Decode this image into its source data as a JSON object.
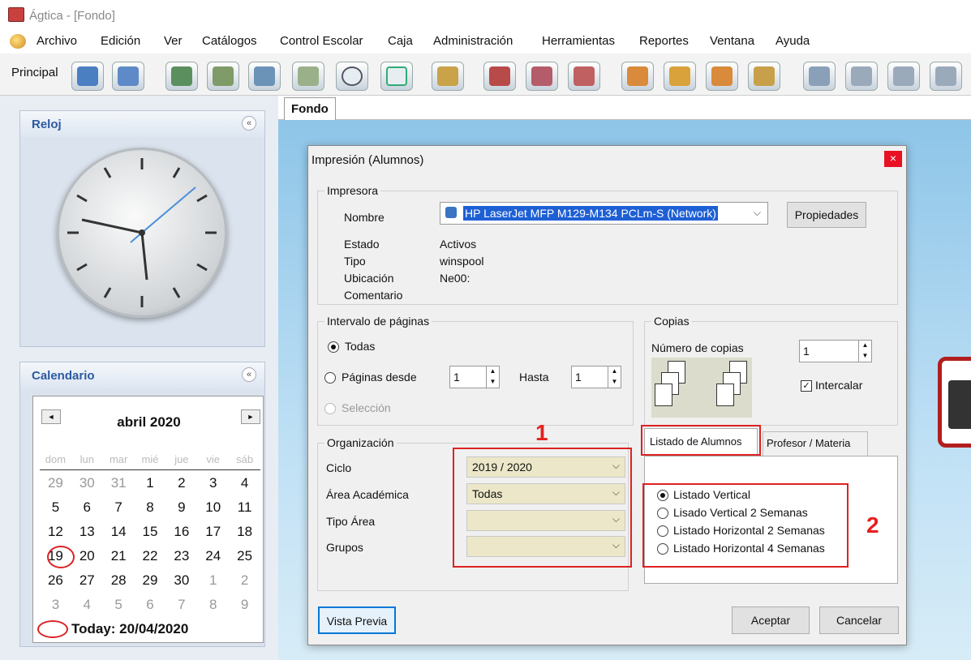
{
  "window": {
    "title": "Ágtica - [Fondo]"
  },
  "menu": [
    "Archivo",
    "Edición",
    "Ver",
    "Catálogos",
    "Control Escolar",
    "Caja",
    "Administración",
    "Herramientas",
    "Reportes",
    "Ventana",
    "Ayuda"
  ],
  "toolbar": {
    "label": "Principal"
  },
  "left": {
    "clock_title": "Reloj",
    "calendar_title": "Calendario",
    "collapse": "«"
  },
  "calendar": {
    "month": "abril 2020",
    "prev": "◄",
    "next": "►",
    "dow": [
      "dom",
      "lun",
      "mar",
      "mié",
      "jue",
      "vie",
      "sáb"
    ],
    "weeks": [
      [
        "29",
        "30",
        "31",
        "1",
        "2",
        "3",
        "4"
      ],
      [
        "5",
        "6",
        "7",
        "8",
        "9",
        "10",
        "11"
      ],
      [
        "12",
        "13",
        "14",
        "15",
        "16",
        "17",
        "18"
      ],
      [
        "19",
        "20",
        "21",
        "22",
        "23",
        "24",
        "25"
      ],
      [
        "26",
        "27",
        "28",
        "29",
        "30",
        "1",
        "2"
      ],
      [
        "3",
        "4",
        "5",
        "6",
        "7",
        "8",
        "9"
      ]
    ],
    "today": "Today: 20/04/2020"
  },
  "tab": {
    "label": "Fondo"
  },
  "dialog": {
    "title": "Impresión (Alumnos)",
    "close": "×",
    "printer": {
      "group": "Impresora",
      "name_label": "Nombre",
      "name_value": "HP LaserJet MFP M129-M134 PCLm-S (Network)",
      "properties": "Propiedades",
      "status_label": "Estado",
      "status_value": "Activos",
      "type_label": "Tipo",
      "type_value": "winspool",
      "location_label": "Ubicación",
      "location_value": "Ne00:",
      "comment_label": "Comentario"
    },
    "range": {
      "group": "Intervalo de páginas",
      "all": "Todas",
      "pages_from": "Páginas desde",
      "from_value": "1",
      "to_label": "Hasta",
      "to_value": "1",
      "selection": "Selección"
    },
    "copies": {
      "group": "Copias",
      "count_label": "Número de copias",
      "count_value": "1",
      "collate": "Intercalar"
    },
    "org": {
      "group": "Organización",
      "cycle_label": "Ciclo",
      "cycle_value": "2019 / 2020",
      "area_label": "Área Académica",
      "area_value": "Todas",
      "type_label": "Tipo Área",
      "type_value": "",
      "groups_label": "Grupos",
      "groups_value": ""
    },
    "tabs": [
      "Listado de Alumnos",
      "Profesor / Materia"
    ],
    "options": [
      "Listado Vertical",
      "Lisado Vertical 2 Semanas",
      "Listado Horizontal 2 Semanas",
      "Listado Horizontal 4 Semanas"
    ],
    "preview": "Vista Previa",
    "accept": "Aceptar",
    "cancel": "Cancelar"
  },
  "annotations": {
    "one": "1",
    "two": "2"
  },
  "colors": {
    "annotation_red": "#d22222",
    "combo_fill": "#ebe7c8",
    "close_red": "#e81123"
  }
}
